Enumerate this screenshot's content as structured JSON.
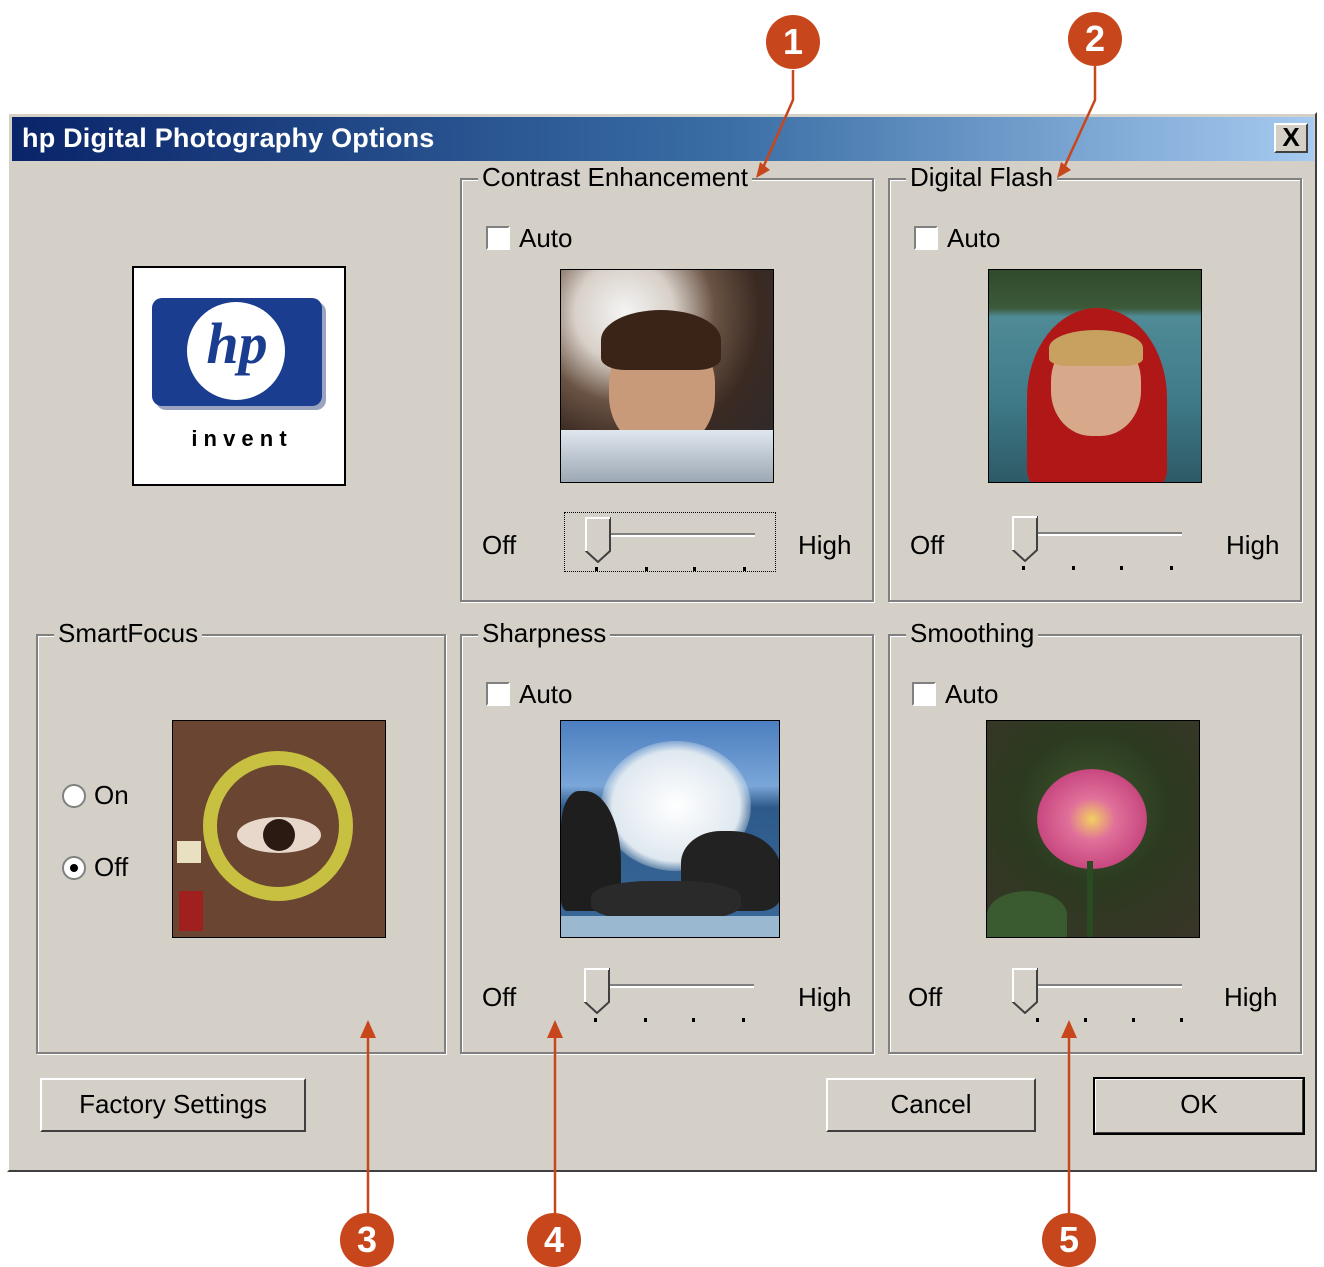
{
  "window": {
    "title": "hp Digital Photography Options",
    "close_glyph": "X"
  },
  "logo": {
    "brand": "hp",
    "tagline": "i n v e n t"
  },
  "contrast": {
    "legend": "Contrast Enhancement",
    "auto_label": "Auto",
    "auto_checked": false,
    "off_label": "Off",
    "high_label": "High",
    "level": 0,
    "photo": "girl-portrait-photo"
  },
  "flash": {
    "legend": "Digital Flash",
    "auto_label": "Auto",
    "auto_checked": false,
    "off_label": "Off",
    "high_label": "High",
    "level": 0,
    "photo": "child-red-hood-photo"
  },
  "smartfocus": {
    "legend": "SmartFocus",
    "on_label": "On",
    "off_label": "Off",
    "selected": "Off",
    "photo": "eye-closeup-photo"
  },
  "sharpness": {
    "legend": "Sharpness",
    "auto_label": "Auto",
    "auto_checked": false,
    "off_label": "Off",
    "high_label": "High",
    "level": 0,
    "photo": "ocean-wave-rocks-photo"
  },
  "smoothing": {
    "legend": "Smoothing",
    "auto_label": "Auto",
    "auto_checked": false,
    "off_label": "Off",
    "high_label": "High",
    "level": 0,
    "photo": "pink-flower-photo"
  },
  "buttons": {
    "factory": "Factory Settings",
    "cancel": "Cancel",
    "ok": "OK"
  },
  "callouts": [
    "1",
    "2",
    "3",
    "4",
    "5"
  ],
  "colors": {
    "callout": "#c8461c",
    "dialog": "#d4d0c8",
    "titlebar": "#0a246a",
    "hp_blue": "#1a3d8f"
  }
}
